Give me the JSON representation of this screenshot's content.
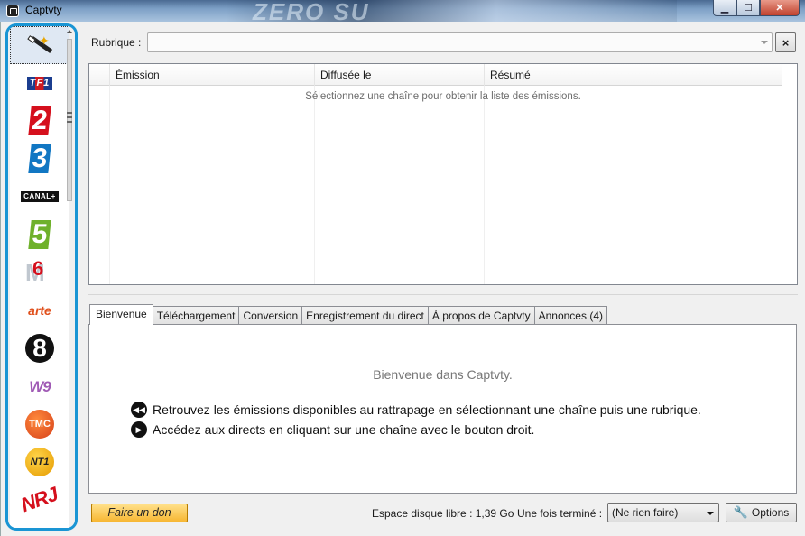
{
  "window": {
    "title": "Captvty",
    "background_text": "ZERO SU",
    "controls": {
      "minimize": "▁",
      "maximize": "☐",
      "close": "✕"
    }
  },
  "channels": [
    {
      "name": "magic-wand-icon",
      "selected": true
    },
    {
      "name": "TF1",
      "logo_text": "TF1"
    },
    {
      "name": "France 2",
      "logo_text": "2"
    },
    {
      "name": "France 3",
      "logo_text": "3"
    },
    {
      "name": "Canal+",
      "logo_text": "CANAL+"
    },
    {
      "name": "France 5",
      "logo_text": "5"
    },
    {
      "name": "M6",
      "logo_text": "6"
    },
    {
      "name": "arte",
      "logo_text": "arte"
    },
    {
      "name": "D8",
      "logo_text": "8"
    },
    {
      "name": "W9",
      "logo_text": "W9"
    },
    {
      "name": "TMC",
      "logo_text": "TMC"
    },
    {
      "name": "NT1",
      "logo_text": "NT1"
    },
    {
      "name": "NRJ 12",
      "logo_text": "NRJ"
    }
  ],
  "rubrique": {
    "label": "Rubrique :",
    "value": "",
    "clear": "×"
  },
  "grid": {
    "columns": [
      "Émission",
      "Diffusée le",
      "Résumé"
    ],
    "empty_message": "Sélectionnez une chaîne pour obtenir la liste des émissions."
  },
  "tabs": [
    {
      "label": "Bienvenue",
      "active": true
    },
    {
      "label": "Téléchargement"
    },
    {
      "label": "Conversion"
    },
    {
      "label": "Enregistrement du direct"
    },
    {
      "label": "À propos de Captvty"
    },
    {
      "label": "Annonces (4)"
    }
  ],
  "welcome": {
    "title": "Bienvenue dans Captvty.",
    "tips": [
      "Retrouvez les émissions disponibles au rattrapage en sélectionnant une chaîne puis une rubrique.",
      "Accédez aux directs en cliquant sur une chaîne avec le bouton droit."
    ]
  },
  "status": {
    "donate": "Faire un don",
    "disk_space": "Espace disque libre : 1,39 Go",
    "after_label": "Une fois terminé :",
    "after_value": "(Ne rien faire)",
    "options": "Options"
  },
  "colors": {
    "sidebar_highlight": "#1a95d4",
    "donate_button": "#f7b733"
  }
}
